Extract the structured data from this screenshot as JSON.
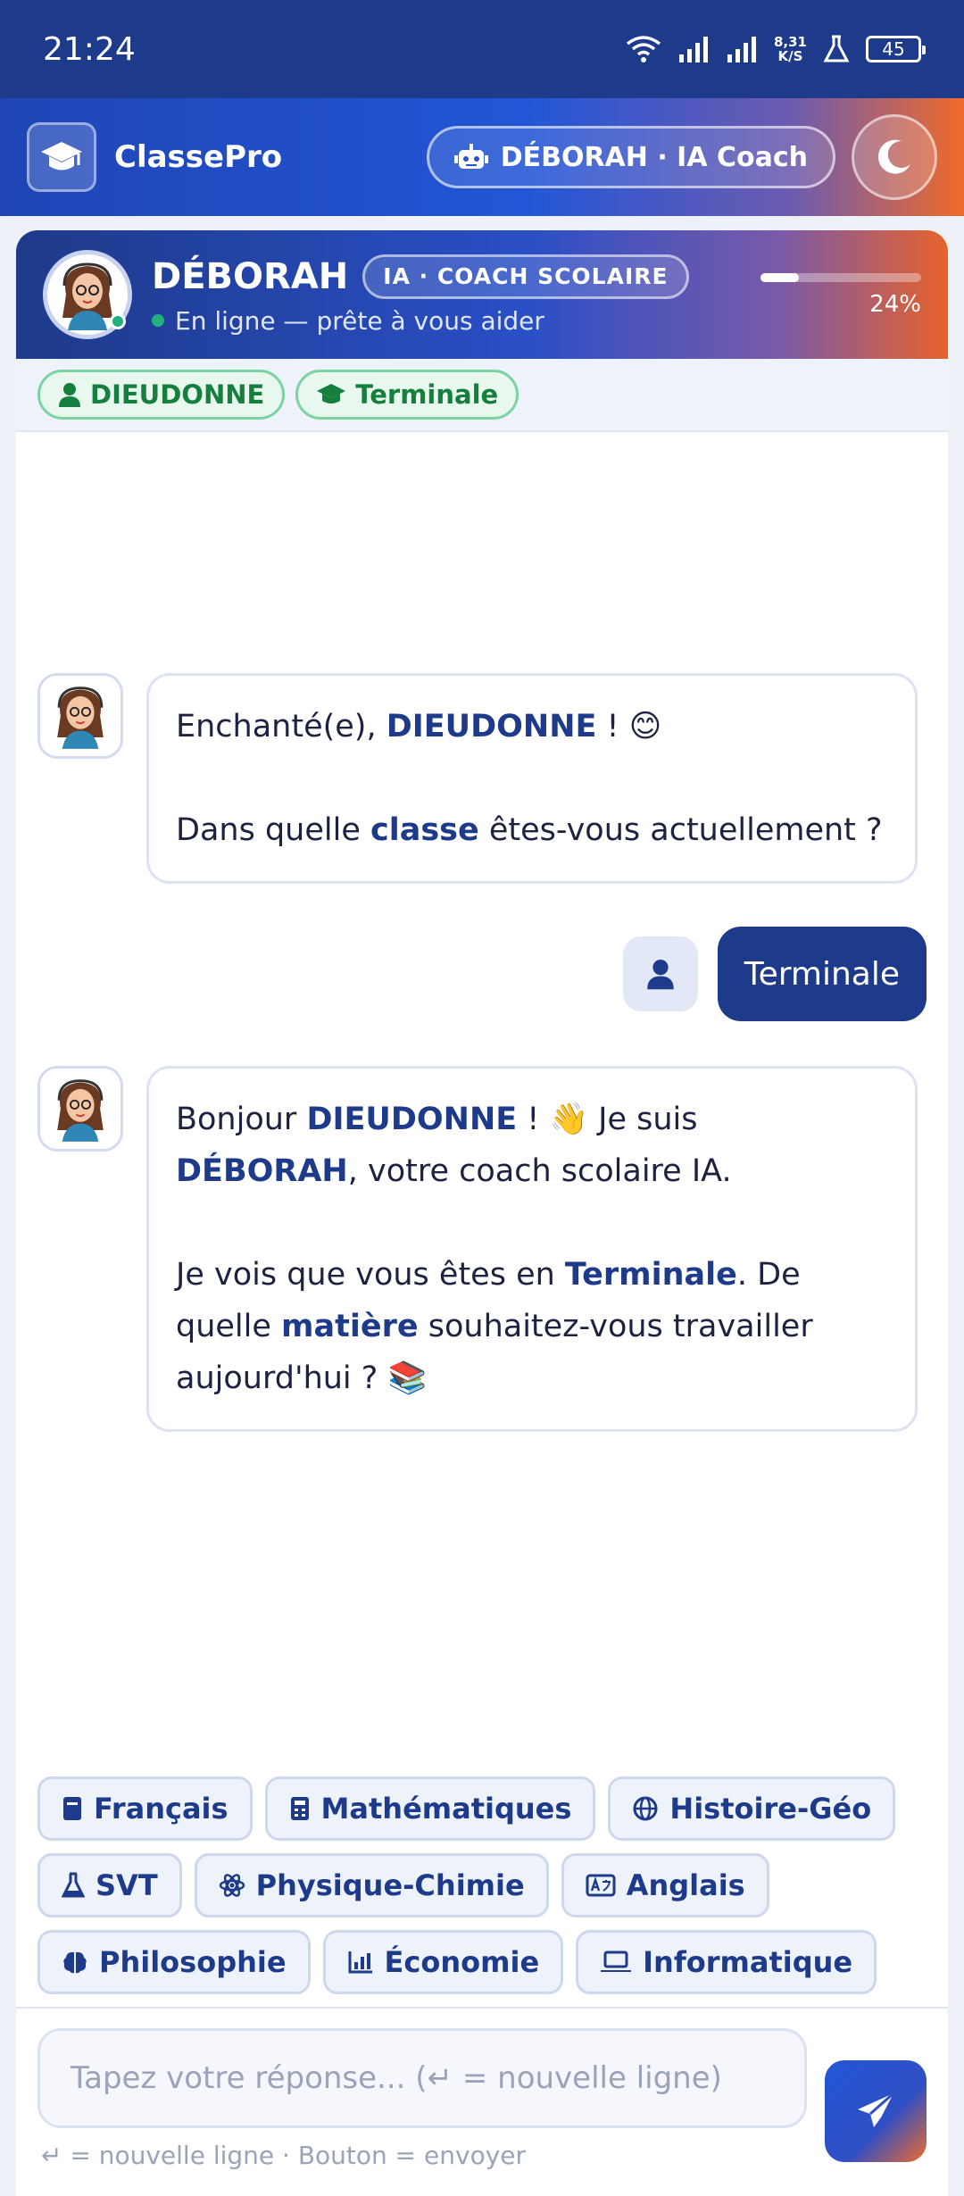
{
  "status_bar": {
    "time": "21:24",
    "net_speed_value": "8,31",
    "net_speed_unit": "K/S",
    "battery": "45"
  },
  "app": {
    "brand": "ClassePro",
    "coach_pill": "DÉBORAH · IA Coach"
  },
  "coach": {
    "name": "DÉBORAH",
    "badge": "IA · COACH SCOLAIRE",
    "status": "En ligne — prête à vous aider",
    "progress": 24,
    "progress_label": "24%"
  },
  "tags": {
    "student": "DIEUDONNE",
    "level": "Terminale"
  },
  "messages": {
    "m1": {
      "l1_a": "Enchanté(e), ",
      "l1_b": "DIEUDONNE",
      "l1_c": " ! 😊",
      "l2_a": "Dans quelle ",
      "l2_b": "classe",
      "l2_c": " êtes-vous actuellement ?"
    },
    "user_reply": "Terminale",
    "m2": {
      "p1_a": "Bonjour ",
      "p1_b": "DIEUDONNE",
      "p1_c": " ! 👋 Je suis ",
      "p1_d": "DÉBORAH",
      "p1_e": ", votre coach scolaire IA.",
      "p2_a": "Je vois que vous êtes en ",
      "p2_b": "Terminale",
      "p2_c": ". De quelle ",
      "p2_d": "matière",
      "p2_e": " souhaitez-vous travailler aujourd'hui ? 📚"
    }
  },
  "subjects": [
    {
      "label": "Français",
      "icon": "book-icon"
    },
    {
      "label": "Mathématiques",
      "icon": "calculator-icon"
    },
    {
      "label": "Histoire-Géo",
      "icon": "globe-icon"
    },
    {
      "label": "SVT",
      "icon": "flask-icon"
    },
    {
      "label": "Physique-Chimie",
      "icon": "atom-icon"
    },
    {
      "label": "Anglais",
      "icon": "language-icon"
    },
    {
      "label": "Philosophie",
      "icon": "brain-icon"
    },
    {
      "label": "Économie",
      "icon": "chart-icon"
    },
    {
      "label": "Informatique",
      "icon": "laptop-icon"
    }
  ],
  "composer": {
    "placeholder": "Tapez votre réponse... (↵ = nouvelle ligne)",
    "hint": "↵ = nouvelle ligne  ·  Bouton = envoyer"
  },
  "colors": {
    "primary": "#1e3a8a",
    "accent_orange": "#f06a2a",
    "success": "#15803d"
  }
}
